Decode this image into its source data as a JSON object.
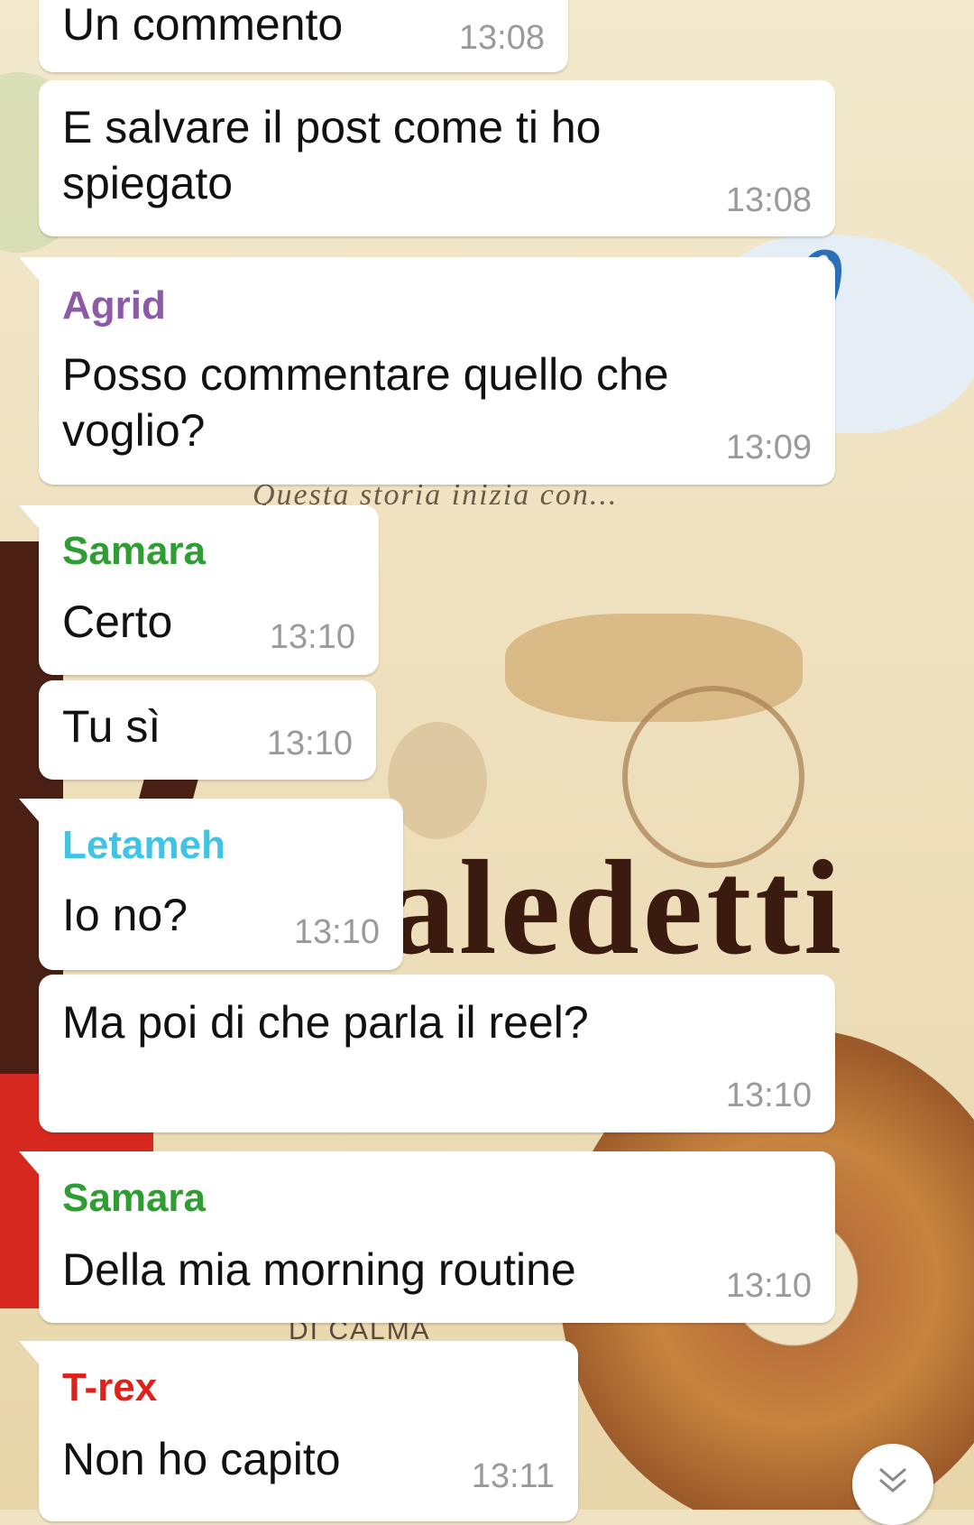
{
  "wallpaper": {
    "script_text": "Questa storia inizia con...",
    "brand_fragment": "aledetti",
    "bottom_text": "DI CALMA"
  },
  "messages": [
    {
      "sender": "",
      "sender_color": "",
      "text": "Un commento",
      "time": "13:08"
    },
    {
      "sender": "",
      "sender_color": "",
      "text": "E salvare il post come ti ho spiegato",
      "time": "13:08"
    },
    {
      "sender": "Agrid",
      "sender_color": "#8e5aa8",
      "text": "Posso commentare quello che voglio?",
      "time": "13:09"
    },
    {
      "sender": "Samara",
      "sender_color": "#2e9e33",
      "text": "Certo",
      "time": "13:10"
    },
    {
      "sender": "",
      "sender_color": "",
      "text": "Tu sì",
      "time": "13:10"
    },
    {
      "sender": "Letameh",
      "sender_color": "#3fc3e6",
      "text": "Io no?",
      "time": "13:10"
    },
    {
      "sender": "",
      "sender_color": "",
      "text": "Ma poi di che parla il reel?",
      "time": "13:10"
    },
    {
      "sender": "Samara",
      "sender_color": "#2e9e33",
      "text": "Della mia morning routine",
      "time": "13:10"
    },
    {
      "sender": "T-rex",
      "sender_color": "#e0201a",
      "text": "Non ho capito",
      "time": "13:11"
    }
  ],
  "icons": {
    "scroll_down": "double-chevron-down-icon"
  }
}
